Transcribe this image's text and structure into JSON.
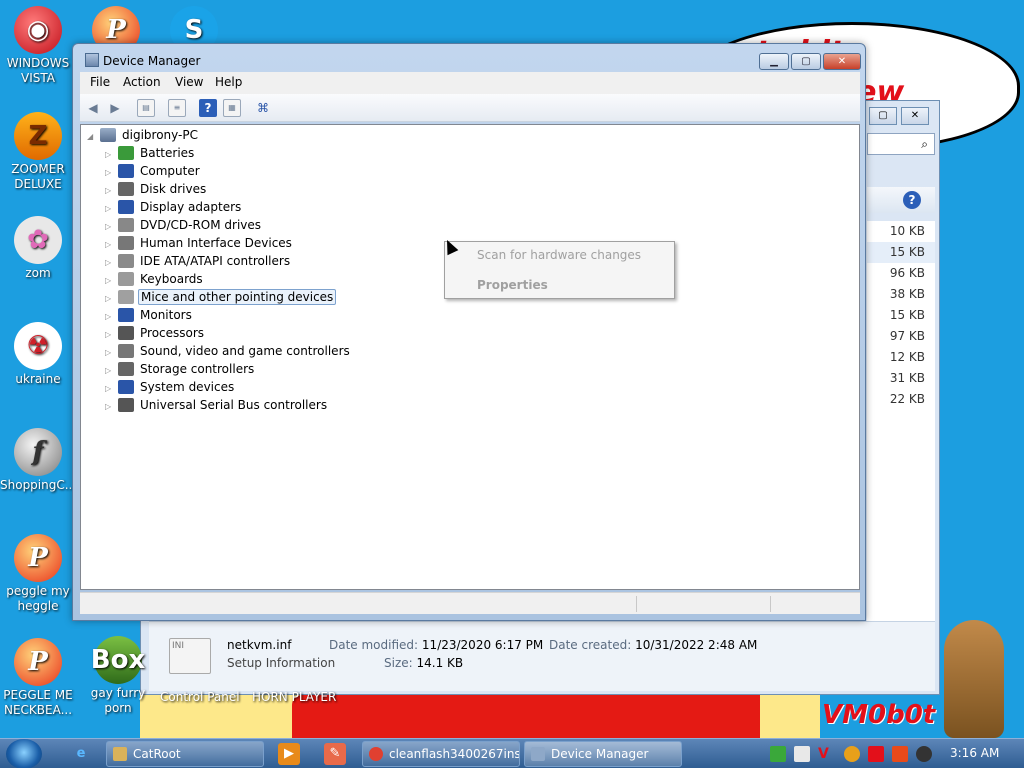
{
  "desktop": {
    "icons": [
      {
        "label": "WINDOWS VISTA"
      },
      {
        "label": "ZOOMER DELUXE"
      },
      {
        "label": "zom"
      },
      {
        "label": "ukraine"
      },
      {
        "label": "ShoppingC..."
      },
      {
        "label": "peggle my heggle"
      },
      {
        "label": "PEGGLE ME NECKBEA..."
      },
      {
        "label": "gay furry porn"
      }
    ],
    "bubble_line1": "eat shit",
    "bubble_line2": "chew",
    "watermark": "VM0b0t",
    "partial_labels": [
      "Control Panel",
      "HORN PLAYER"
    ]
  },
  "explorer": {
    "search_icon": "search-icon",
    "sizes": [
      "10 KB",
      "15 KB",
      "96 KB",
      "38 KB",
      "15 KB",
      "97 KB",
      "12 KB",
      "31 KB",
      "22 KB"
    ],
    "selected_index": 1,
    "details": {
      "file_name": "netkvm.inf",
      "file_type": "Setup Information",
      "date_modified_label": "Date modified:",
      "date_modified": "11/23/2020 6:17 PM",
      "date_created_label": "Date created:",
      "date_created": "10/31/2022 2:48 AM",
      "size_label": "Size:",
      "size": "14.1 KB"
    }
  },
  "device_manager": {
    "title": "Device Manager",
    "menu": [
      "File",
      "Action",
      "View",
      "Help"
    ],
    "root": "digibrony-PC",
    "nodes": [
      {
        "label": "Batteries",
        "color": "#3a9a3a"
      },
      {
        "label": "Computer",
        "color": "#2a55a8"
      },
      {
        "label": "Disk drives",
        "color": "#666666"
      },
      {
        "label": "Display adapters",
        "color": "#2a55a8"
      },
      {
        "label": "DVD/CD-ROM drives",
        "color": "#888888"
      },
      {
        "label": "Human Interface Devices",
        "color": "#777777"
      },
      {
        "label": "IDE ATA/ATAPI controllers",
        "color": "#8a8a8a"
      },
      {
        "label": "Keyboards",
        "color": "#9a9a9a"
      },
      {
        "label": "Mice and other pointing devices",
        "color": "#a0a0a0"
      },
      {
        "label": "Monitors",
        "color": "#2a55a8"
      },
      {
        "label": "Processors",
        "color": "#555555"
      },
      {
        "label": "Sound, video and game controllers",
        "color": "#777777"
      },
      {
        "label": "Storage controllers",
        "color": "#666666"
      },
      {
        "label": "System devices",
        "color": "#2a55a8"
      },
      {
        "label": "Universal Serial Bus controllers",
        "color": "#555555"
      }
    ],
    "selected_node": "Mice and other pointing devices"
  },
  "context_menu": {
    "items": [
      "Scan for hardware changes",
      "Properties"
    ]
  },
  "taskbar": {
    "tasks": [
      {
        "label": "CatRoot",
        "color": "#d9b25a"
      },
      {
        "label": "cleanflash3400267ins...",
        "color": "#e04030"
      },
      {
        "label": "Device Manager",
        "color": "#8ea8c8"
      }
    ],
    "clock": "3:16 AM"
  }
}
